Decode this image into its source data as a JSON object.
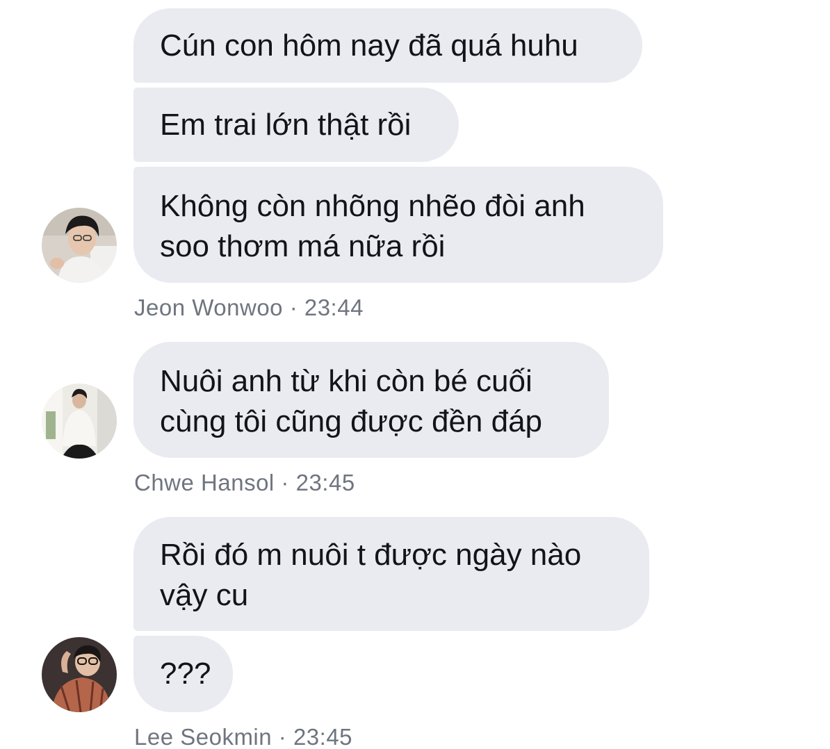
{
  "messages": [
    {
      "group": 1,
      "bubbles": [
        "Cún con hôm nay đã quá huhu",
        "Em trai lớn thật rồi",
        "Không còn nhõng nhẽo đòi anh\nsoo thơm má nữa rồi"
      ],
      "meta": "Jeon Wonwoo · 23:44",
      "avatar_icon": "user-avatar-photo"
    },
    {
      "group": 2,
      "bubbles": [
        "Nuôi anh từ khi còn bé cuối\ncùng tôi cũng được đền đáp"
      ],
      "meta": "Chwe Hansol · 23:45",
      "avatar_icon": "user-avatar-photo"
    },
    {
      "group": 3,
      "bubbles": [
        "Rồi đó m nuôi t được ngày nào\nvậy cu",
        "???"
      ],
      "meta": "Lee Seokmin · 23:45",
      "avatar_icon": "user-avatar-photo"
    }
  ],
  "colors": {
    "bubble_bg": "#e9ebf0",
    "bubble_text": "#111418",
    "meta_text": "#6f757f",
    "background": "#ffffff"
  }
}
